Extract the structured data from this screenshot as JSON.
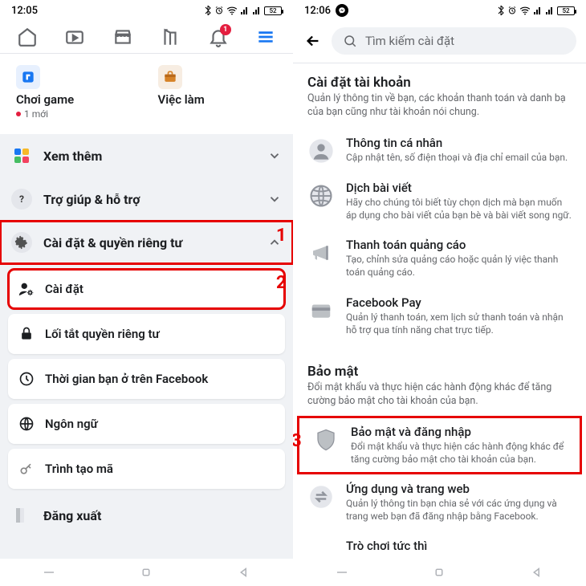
{
  "left": {
    "time": "12:05",
    "battery": "52",
    "shortcuts": {
      "game": {
        "title": "Chơi game",
        "sub": "1 mới"
      },
      "jobs": {
        "title": "Việc làm"
      }
    },
    "see_more": "Xem thêm",
    "help": "Trợ giúp & hỗ trợ",
    "settings_privacy": "Cài đặt & quyền riêng tư",
    "settings": "Cài đặt",
    "privacy_shortcut": "Lối tắt quyền riêng tư",
    "time_on_fb": "Thời gian bạn ở trên Facebook",
    "language": "Ngôn ngữ",
    "code_gen": "Trình tạo mã",
    "logout": "Đăng xuất",
    "notif_count": "1",
    "step1": "1",
    "step2": "2"
  },
  "right": {
    "time": "12:06",
    "battery": "52",
    "search_placeholder": "Tìm kiếm cài đặt",
    "account_section": {
      "title": "Cài đặt tài khoản",
      "desc": "Quản lý thông tin về bạn, các khoản thanh toán và danh bạ của bạn cũng như tài khoản nói chung."
    },
    "personal": {
      "title": "Thông tin cá nhân",
      "sub": "Cập nhật tên, số điện thoại và địa chỉ email của bạn."
    },
    "translate": {
      "title": "Dịch bài viết",
      "sub": "Hãy cho chúng tôi biết tùy chọn dịch mà bạn muốn áp dụng cho bài viết của bạn bè và bài viết song ngữ."
    },
    "ads": {
      "title": "Thanh toán quảng cáo",
      "sub": "Tạo, chỉnh sửa quảng cáo hoặc quản lý việc thanh toán quảng cáo."
    },
    "pay": {
      "title": "Facebook Pay",
      "sub": "Quản lý thanh toán, xem lịch sử thanh toán và nhận hỗ trợ qua tính năng chat trực tiếp."
    },
    "security_section": {
      "title": "Bảo mật",
      "desc": "Đổi mật khẩu và thực hiện các hành động khác để tăng cường bảo mật cho tài khoản của bạn."
    },
    "security_login": {
      "title": "Bảo mật và đăng nhập",
      "sub": "Đổi mật khẩu và thực hiện các hành động khác để tăng cường bảo mật cho tài khoản của bạn."
    },
    "apps": {
      "title": "Ứng dụng và trang web",
      "sub": "Quản lý thông tin bạn chia sẻ với các ứng dụng và trang web bạn đã đăng nhập bằng Facebook."
    },
    "instant": {
      "title": "Trò chơi tức thì"
    },
    "step3": "3"
  }
}
